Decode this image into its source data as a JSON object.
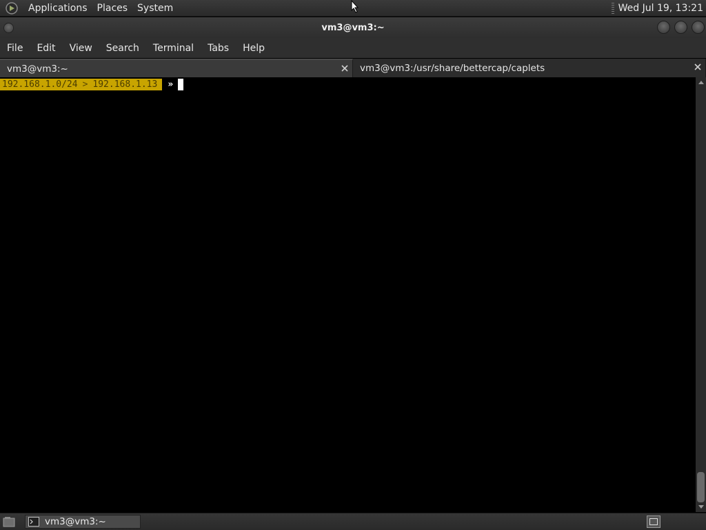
{
  "top_panel": {
    "menus": [
      "Applications",
      "Places",
      "System"
    ],
    "clock": "Wed Jul 19, 13:21"
  },
  "window": {
    "title": "vm3@vm3:~",
    "menu": [
      "File",
      "Edit",
      "View",
      "Search",
      "Terminal",
      "Tabs",
      "Help"
    ],
    "tabs": [
      {
        "label": "vm3@vm3:~",
        "active": true
      },
      {
        "label": "vm3@vm3:/usr/share/bettercap/caplets",
        "active": false
      }
    ]
  },
  "terminal": {
    "prompt_subnet": "192.168.1.0/24",
    "prompt_separator": ">",
    "prompt_host": "192.168.1.13",
    "prompt_arrow": "»"
  },
  "taskbar": {
    "items": [
      {
        "label": "vm3@vm3:~"
      }
    ]
  },
  "colors": {
    "prompt_bg": "#c8a400",
    "terminal_bg": "#000000",
    "panel_bg": "#2f2f2f"
  },
  "icons": [
    "app-logo-icon",
    "close-icon",
    "scroll-up-icon",
    "scroll-down-icon",
    "show-desktop-icon",
    "terminal-icon",
    "workspace-icon"
  ]
}
